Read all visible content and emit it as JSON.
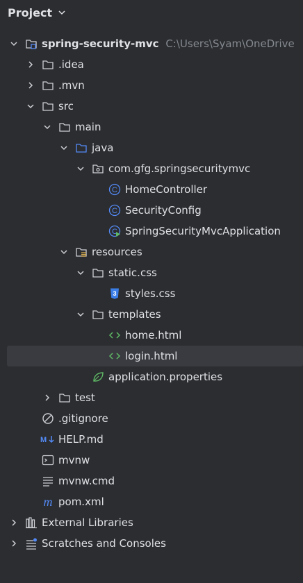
{
  "header": {
    "title": "Project"
  },
  "tree": {
    "root_label": "spring-security-mvc",
    "root_path": "C:\\Users\\Syam\\OneDrive",
    "idea": ".idea",
    "mvn": ".mvn",
    "src": "src",
    "main": "main",
    "java": "java",
    "package": "com.gfg.springsecuritymvc",
    "home_controller": "HomeController",
    "security_config": "SecurityConfig",
    "app_class": "SpringSecurityMvcApplication",
    "resources": "resources",
    "static_css": "static.css",
    "styles_css": "styles.css",
    "templates": "templates",
    "home_html": "home.html",
    "login_html": "login.html",
    "app_properties": "application.properties",
    "test": "test",
    "gitignore": ".gitignore",
    "help_md": "HELP.md",
    "mvnw": "mvnw",
    "mvnw_cmd": "mvnw.cmd",
    "pom_xml": "pom.xml",
    "external_libraries": "External Libraries",
    "scratches": "Scratches and Consoles"
  },
  "colors": {
    "background": "#2b2d30",
    "selection": "#393b40",
    "text": "#dfe1e5",
    "muted": "#868a91",
    "folder_blue": "#548af7",
    "spring_green": "#5fb865",
    "css_blue": "#3b7ee8",
    "html_green": "#5fb865"
  }
}
